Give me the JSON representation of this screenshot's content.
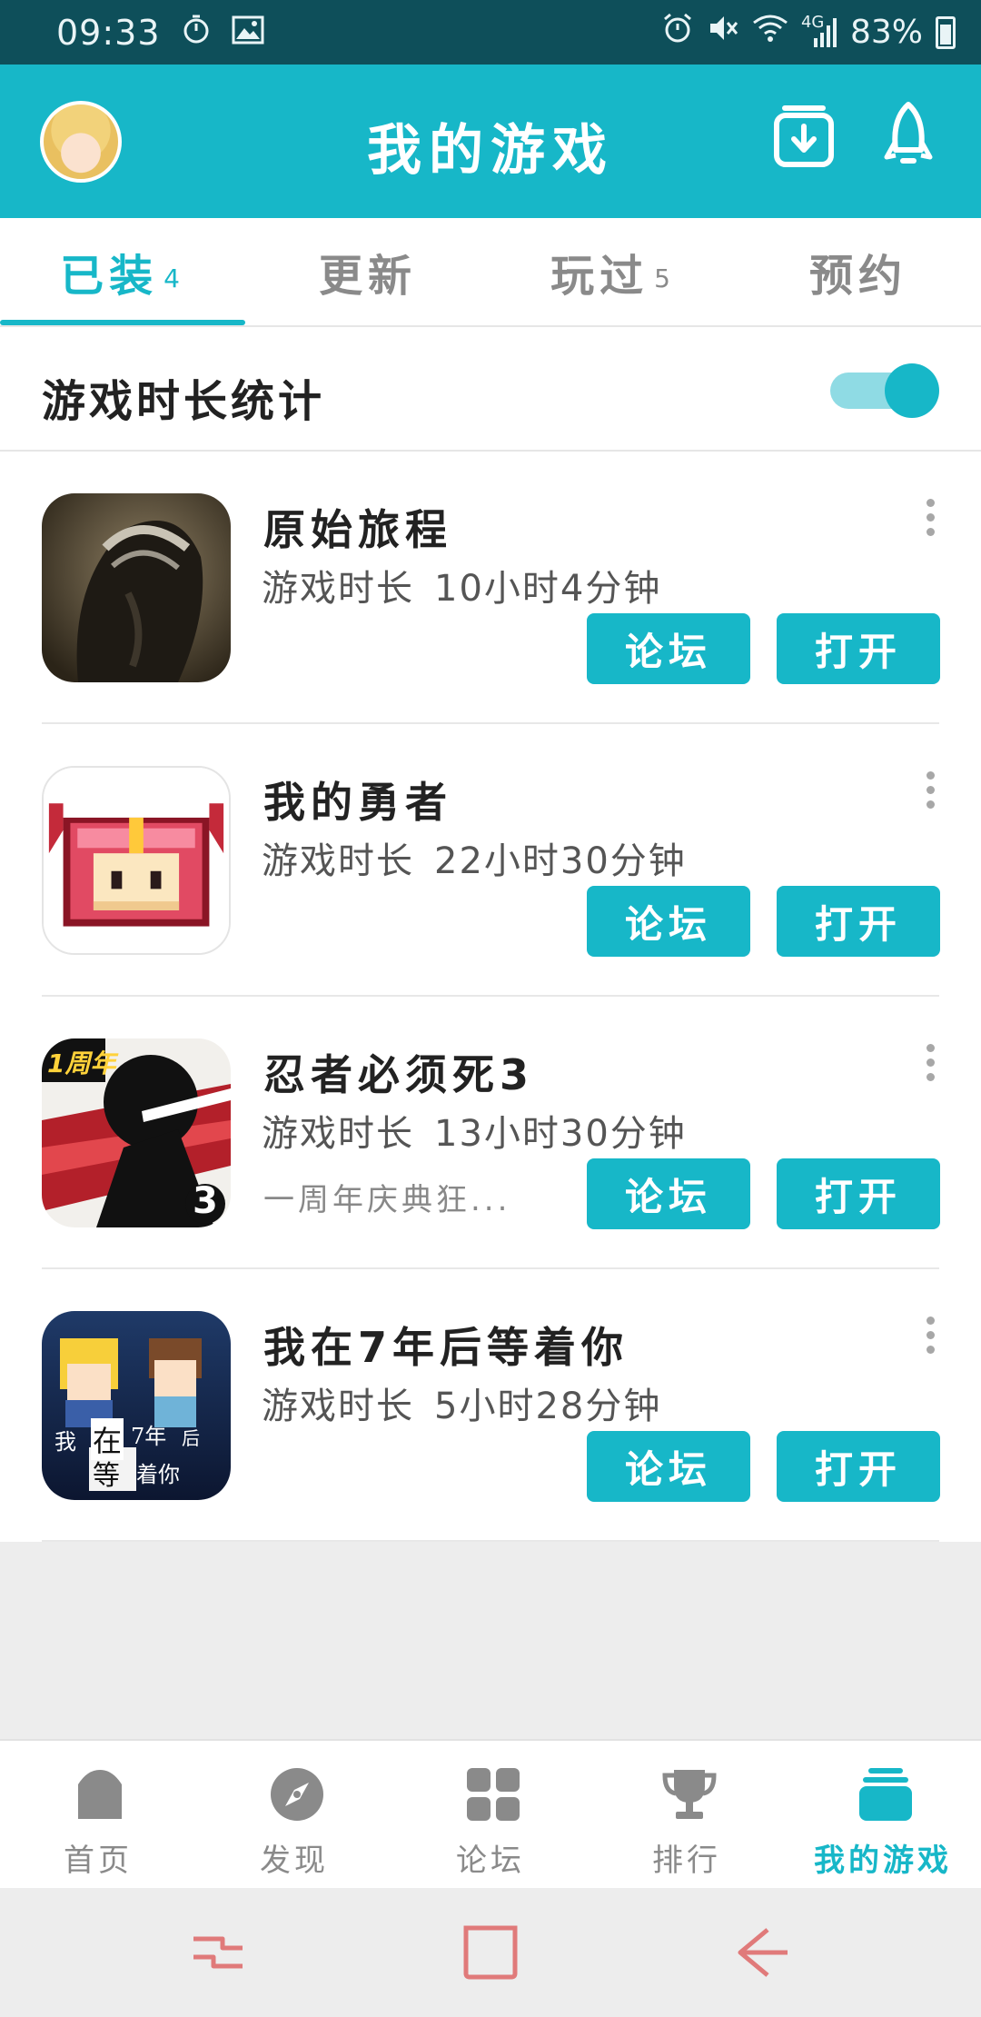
{
  "status_bar": {
    "time": "09:33",
    "signal": "4G",
    "battery": "83%"
  },
  "header": {
    "title": "我的游戏"
  },
  "tabs": [
    {
      "label": "已装",
      "count": "4"
    },
    {
      "label": "更新",
      "count": ""
    },
    {
      "label": "玩过",
      "count": "5"
    },
    {
      "label": "预约",
      "count": ""
    }
  ],
  "stats": {
    "label": "游戏时长统计",
    "enabled": true
  },
  "games": [
    {
      "name": "原始旅程",
      "playtime_label": "游戏时长",
      "playtime": "10小时4分钟",
      "promo": "",
      "forum_label": "论坛",
      "open_label": "打开"
    },
    {
      "name": "我的勇者",
      "playtime_label": "游戏时长",
      "playtime": "22小时30分钟",
      "promo": "",
      "forum_label": "论坛",
      "open_label": "打开"
    },
    {
      "name": "忍者必须死3",
      "playtime_label": "游戏时长",
      "playtime": "13小时30分钟",
      "promo": "一周年庆典狂...",
      "forum_label": "论坛",
      "open_label": "打开",
      "icon_badge": "1周年",
      "icon_number": "3"
    },
    {
      "name": "我在7年后等着你",
      "playtime_label": "游戏时长",
      "playtime": "5小时28分钟",
      "promo": "",
      "forum_label": "论坛",
      "open_label": "打开",
      "icon_text_1": "我",
      "icon_text_2": "在",
      "icon_text_3": "7年",
      "icon_text_4": "后",
      "icon_text_5": "等",
      "icon_text_6": "着你"
    }
  ],
  "bottom_nav": [
    {
      "label": "首页",
      "icon": "home-icon"
    },
    {
      "label": "发现",
      "icon": "compass-icon"
    },
    {
      "label": "论坛",
      "icon": "grid-icon"
    },
    {
      "label": "排行",
      "icon": "trophy-icon"
    },
    {
      "label": "我的游戏",
      "icon": "games-stack-icon",
      "active": true
    }
  ],
  "colors": {
    "accent": "#17b7c8",
    "status_bar": "#0e4f5a",
    "system_nav": "#e07a7a"
  }
}
